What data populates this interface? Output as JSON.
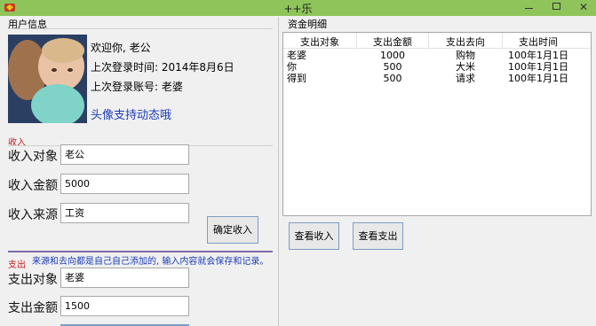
{
  "window": {
    "title": "++乐"
  },
  "user_info": {
    "group_label": "用户信息",
    "welcome": "欢迎你, 老公",
    "last_login_time": "上次登录时间: 2014年8月6日",
    "last_login_account": "上次登录账号: 老婆",
    "avatar_note": "头像支持动态哦"
  },
  "income": {
    "group_label": "收入",
    "target_label": "收入对象",
    "target_value": "老公",
    "amount_label": "收入金额",
    "amount_value": "5000",
    "source_label": "收入来源",
    "source_value": "工资",
    "confirm_button": "确定收入"
  },
  "expense": {
    "group_label": "支出",
    "note": "来源和去向都是自己自己添加的, 输入内容就会保存和记录。",
    "target_label": "支出对象",
    "target_value": "老婆",
    "amount_label": "支出金额",
    "amount_value": "1500"
  },
  "funds": {
    "group_label": "资金明细",
    "columns": [
      "支出对象",
      "支出金额",
      "支出去向",
      "支出时间"
    ],
    "rows": [
      [
        "老婆",
        "1000",
        "购物",
        "100年1月1日"
      ],
      [
        "你",
        "500",
        "大米",
        "100年1月1日"
      ],
      [
        "得到",
        "500",
        "请求",
        "100年1月1日"
      ]
    ],
    "view_income_button": "查看收入",
    "view_expense_button": "查看支出"
  },
  "colors": {
    "titlebar": "#8fc45a",
    "link_blue": "#1b3bb5",
    "accent_red": "#c81e1e",
    "divider_purple": "#7d6aa8"
  },
  "icons": {
    "app": "app-icon",
    "minimize": "minimize-icon",
    "maximize": "maximize-icon",
    "close": "close-icon"
  }
}
